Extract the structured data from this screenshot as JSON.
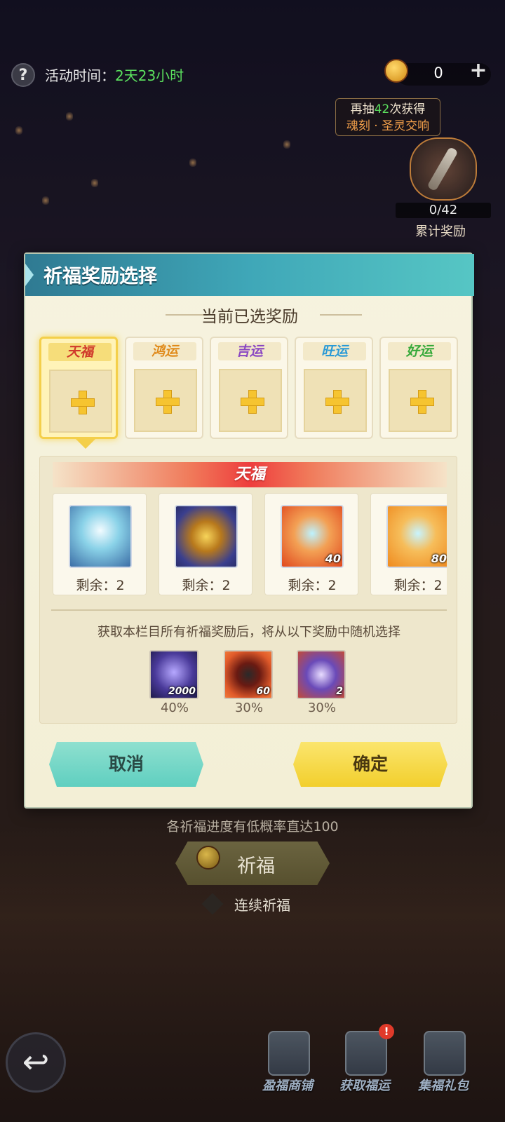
{
  "top": {
    "event_time_label": "活动时间：",
    "event_time_value": "2天23小时",
    "coin_count": "0",
    "draw_tip_prefix": "再抽",
    "draw_tip_count": "42",
    "draw_tip_suffix": "次获得",
    "draw_tip_reward": "魂刻 · 圣灵交响",
    "accum_progress": "0/42",
    "accum_label": "累计奖励"
  },
  "modal": {
    "title": "祈福奖励选择",
    "section_title": "当前已选奖励",
    "slots": [
      {
        "label": "天福",
        "color": "#d0392b"
      },
      {
        "label": "鸿运",
        "color": "#e08a1a"
      },
      {
        "label": "吉运",
        "color": "#8a47c2"
      },
      {
        "label": "旺运",
        "color": "#2a9ad6"
      },
      {
        "label": "好运",
        "color": "#36a93a"
      }
    ],
    "tier_banner": "天福",
    "rewards": [
      {
        "remain": "剩余：2",
        "qty": "",
        "icon": "silver-crown-helmet-icon"
      },
      {
        "remain": "剩余：2",
        "qty": "",
        "icon": "golden-treasure-chest-icon"
      },
      {
        "remain": "剩余：2",
        "qty": "40",
        "icon": "crystal-astrolabe-icon"
      },
      {
        "remain": "剩余：2",
        "qty": "80",
        "icon": "crystal-astrolabe-icon"
      }
    ],
    "random_note": "获取本栏目所有祈福奖励后，将从以下奖励中随机选择",
    "random_items": [
      {
        "qty": "2000",
        "pct": "40%",
        "icon": "purple-scroll-icon"
      },
      {
        "qty": "60",
        "pct": "30%",
        "icon": "red-bomb-icon"
      },
      {
        "qty": "2",
        "pct": "30%",
        "icon": "purple-star-icon"
      }
    ],
    "cancel_label": "取消",
    "confirm_label": "确定"
  },
  "bottom": {
    "prob_note": "各祈福进度有低概率直达100",
    "pray_label": "祈福",
    "continuous_label": "连续祈福",
    "nav": [
      {
        "label": "盈福商铺",
        "badge": ""
      },
      {
        "label": "获取福运",
        "badge": "!"
      },
      {
        "label": "集福礼包",
        "badge": ""
      }
    ]
  }
}
